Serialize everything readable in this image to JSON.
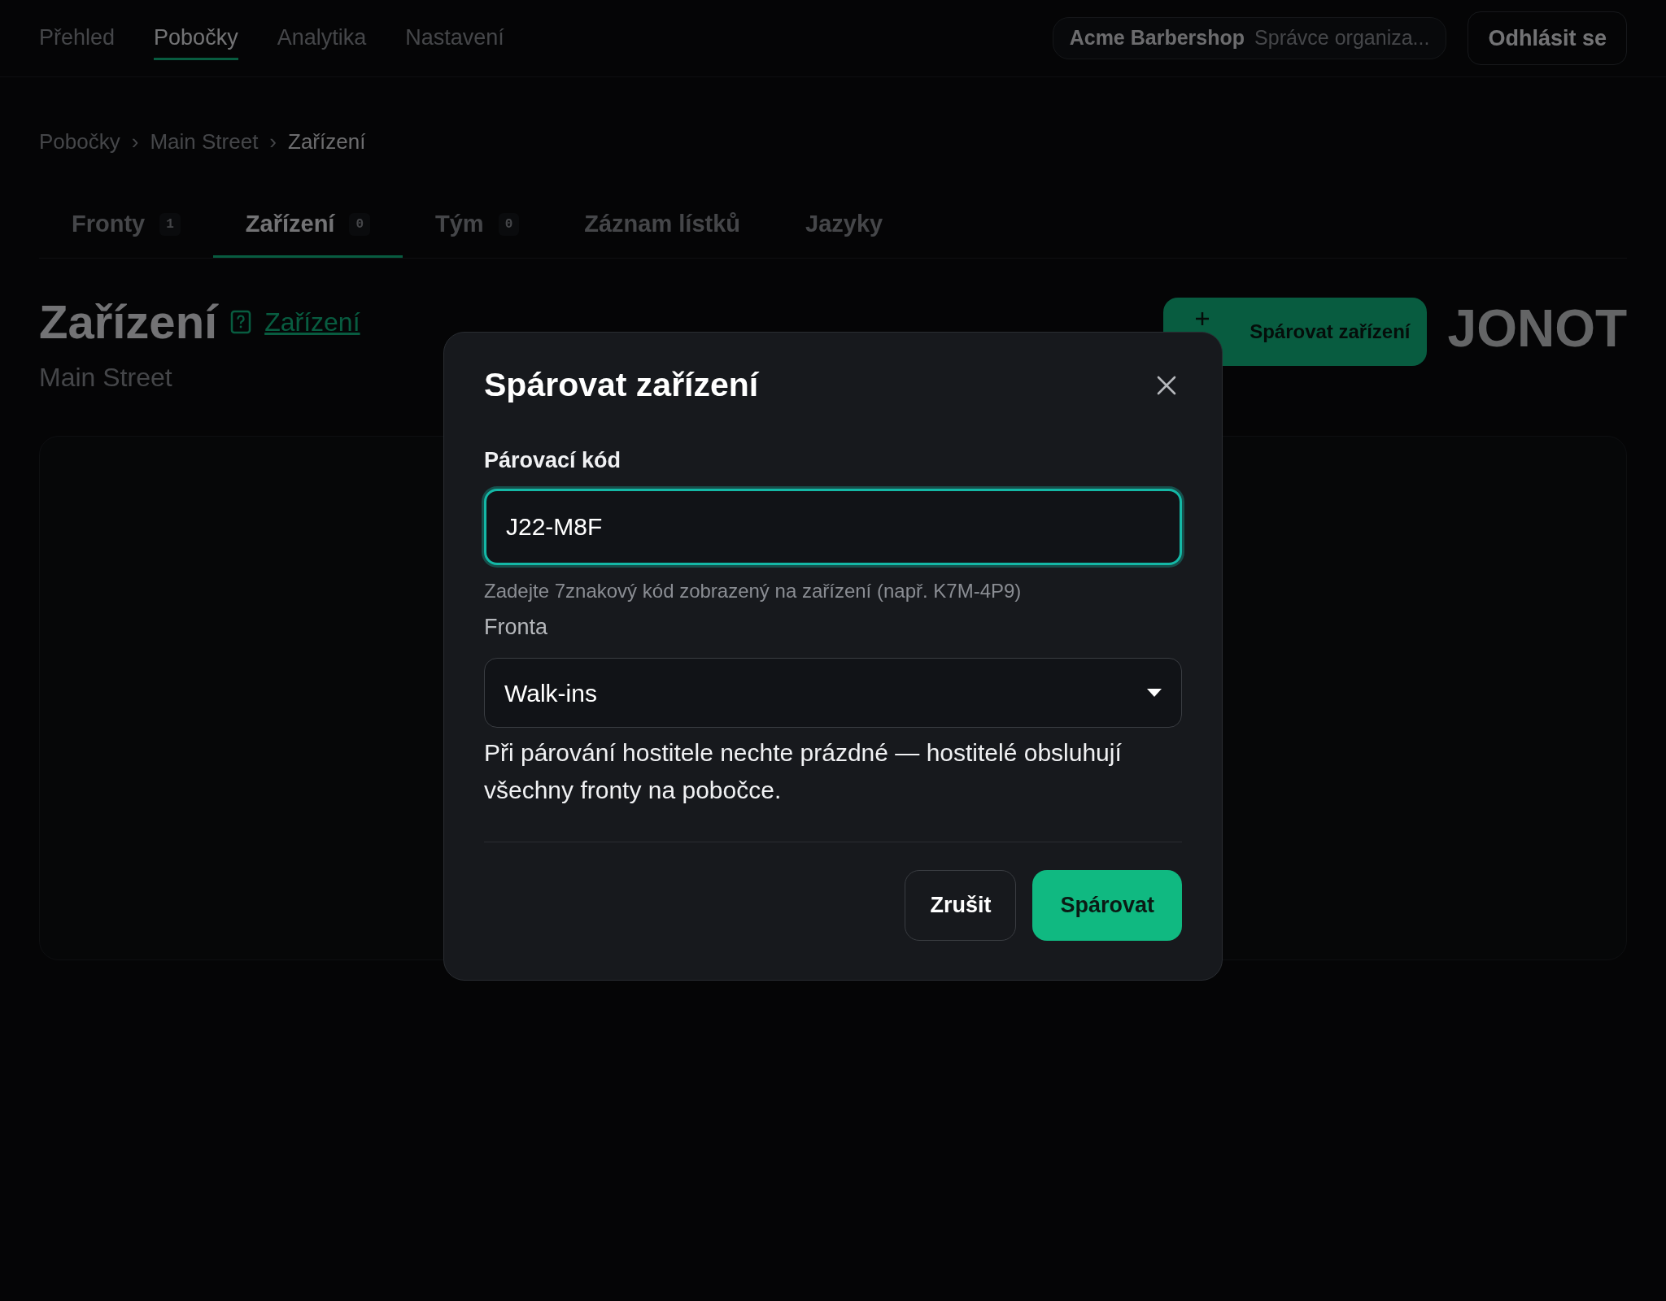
{
  "nav": {
    "items": [
      {
        "label": "Přehled",
        "selected": false
      },
      {
        "label": "Pobočky",
        "selected": true
      },
      {
        "label": "Analytika",
        "selected": false
      },
      {
        "label": "Nastavení",
        "selected": false
      }
    ],
    "org": {
      "name": "Acme Barbershop",
      "role": "Správce organiza..."
    },
    "logout": "Odhlásit se"
  },
  "breadcrumb": {
    "items": [
      "Pobočky",
      "Main Street",
      "Zařízení"
    ],
    "separator": "›"
  },
  "tabs": [
    {
      "label": "Fronty",
      "count": "1",
      "selected": false
    },
    {
      "label": "Zařízení",
      "count": "0",
      "selected": true
    },
    {
      "label": "Tým",
      "count": "0",
      "selected": false
    },
    {
      "label": "Záznam lístků",
      "selected": false
    },
    {
      "label": "Jazyky",
      "selected": false
    }
  ],
  "header": {
    "title": "Zařízení",
    "help_link": "Zařízení",
    "subtitle": "Main Street",
    "pair_button": "Spárovat zařízení",
    "logo": "JONOT"
  },
  "dialog": {
    "title": "Spárovat zařízení",
    "code_label": "Párovací kód",
    "code_value": "J22-M8F",
    "code_hint": "Zadejte 7znakový kód zobrazený na zařízení (např. K7M-4P9)",
    "queue_label": "Fronta",
    "queue_value": "Walk-ins",
    "queue_note": "Při párování hostitele nechte prázdné — hostitelé obsluhují všechny fronty na pobočce.",
    "buttons": [
      {
        "label": "Zrušit",
        "kind": "secondary"
      },
      {
        "label": "Spárovat",
        "kind": "primary"
      }
    ]
  }
}
